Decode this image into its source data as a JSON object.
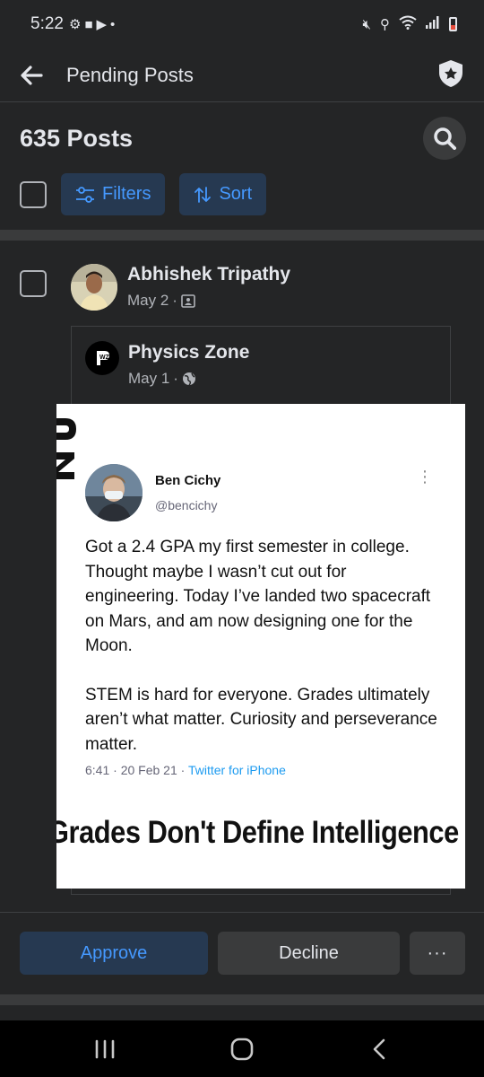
{
  "status_bar": {
    "time": "5:22",
    "left_icons": [
      "settings-icon",
      "bag-icon",
      "youtube-icon",
      "dot-icon"
    ],
    "right_icons": [
      "mute-icon",
      "location-icon",
      "wifi-icon",
      "signal-icon",
      "battery-icon"
    ]
  },
  "header": {
    "title": "Pending Posts",
    "back_icon": "back-arrow-icon",
    "right_icon": "admin-shield-icon"
  },
  "summary": {
    "count": "635 Posts"
  },
  "toolbar": {
    "filters_label": "Filters",
    "sort_label": "Sort"
  },
  "post": {
    "author": "Abhishek Tripathy",
    "date": "May 2",
    "audience_icon": "photo-icon",
    "shared": {
      "group_name": "Physics Zone",
      "date": "May 1",
      "audience_icon": "globe-icon",
      "image": {
        "watermark": "PZ",
        "tweet_name": "Ben Cichy",
        "tweet_handle": "@bencichy",
        "tweet_paragraph_1": "Got a 2.4 GPA my first semester in college. Thought maybe I wasn’t cut out for engineering. Today I’ve landed two spacecraft on Mars, and am now designing one for the Moon.",
        "tweet_paragraph_2": "STEM is hard for everyone. Grades ultimately aren’t what matter.  Curiosity and perseverance matter.",
        "tweet_time": "6:41 · 20 Feb 21 · ",
        "tweet_source": "Twitter for iPhone",
        "caption": "Grades Don't Define Intelligence"
      }
    },
    "actions": {
      "approve_label": "Approve",
      "decline_label": "Decline",
      "more_label": "···"
    }
  },
  "colors": {
    "background": "#242526",
    "accent": "#4599ff",
    "accent_bg": "#263951",
    "surface": "#3a3b3c"
  }
}
